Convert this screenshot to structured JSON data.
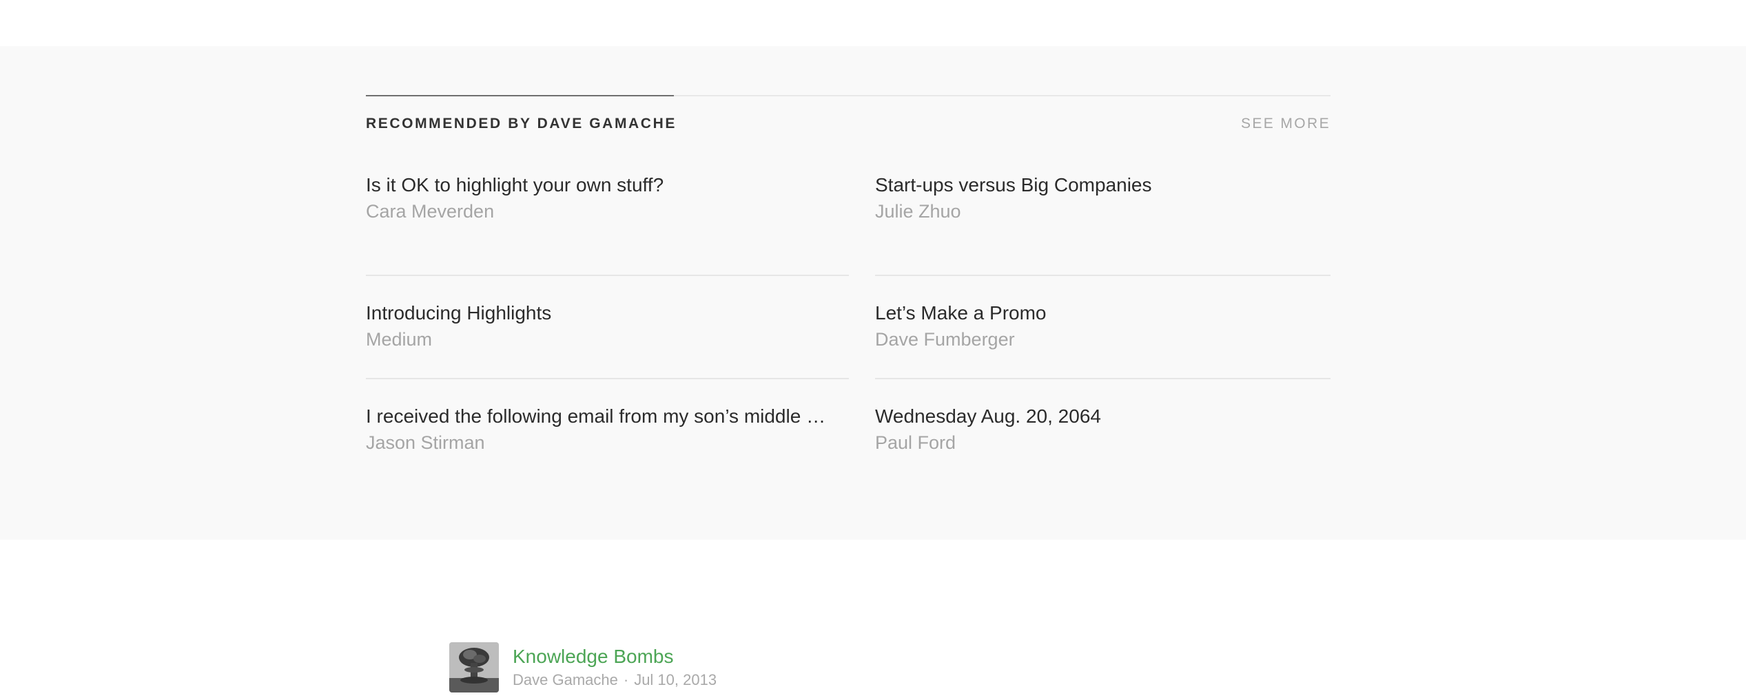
{
  "recommended": {
    "title": "Recommended by Dave Gamache",
    "see_more": "See more",
    "items": [
      {
        "title": "Is it OK to highlight your own stuff?",
        "author": "Cara Meverden"
      },
      {
        "title": "Start-ups versus Big Companies",
        "author": "Julie Zhuo"
      },
      {
        "title": "Introducing Highlights",
        "author": "Medium"
      },
      {
        "title": "Let’s Make a Promo",
        "author": "Dave Fumberger"
      },
      {
        "title": "I received the following email from my son’s middle sc…",
        "author": "Jason Stirman"
      },
      {
        "title": "Wednesday Aug. 20, 2064",
        "author": "Paul Ford"
      }
    ]
  },
  "post_card": {
    "collection": "Knowledge Bombs",
    "author": "Dave Gamache",
    "separator": "·",
    "date": "Jul 10, 2013",
    "thumbnail_icon": "mushroom-cloud-image"
  }
}
